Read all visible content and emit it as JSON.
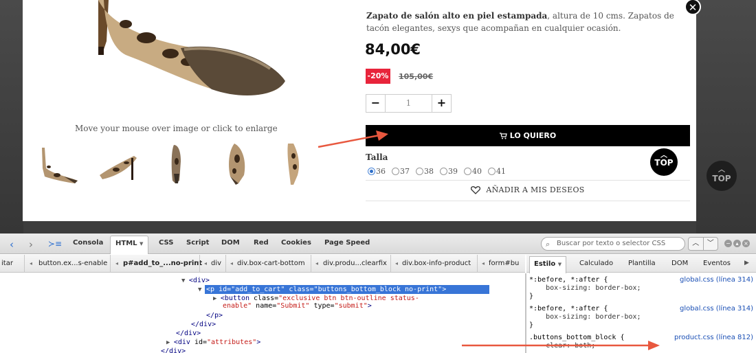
{
  "product": {
    "name_bold": "Zapato de salón alto en piel estampada",
    "description_rest": ", altura de 10 cms. Zapatos de tacón elegantes, sexys que acompañan en cualquier ocasión.",
    "price": "84,00€",
    "discount": "-20%",
    "old_price": "105,00€",
    "quantity": "1",
    "qty_minus": "−",
    "qty_plus": "+",
    "buy_label": "LO QUIERO",
    "buy_icon": "cart-icon",
    "size_label": "Talla",
    "sizes": [
      "36",
      "37",
      "38",
      "39",
      "40",
      "41"
    ],
    "selected_size": "36",
    "wishlist_label": "AÑADIR A MIS DESEOS",
    "enlarge_hint": "Move your mouse over image or click to enlarge",
    "top_label": "TOP",
    "close_symbol": "✕"
  },
  "background": {
    "top_label": "TOP"
  },
  "devtools": {
    "tabs": [
      "Consola",
      "HTML",
      "CSS",
      "Script",
      "DOM",
      "Red",
      "Cookies",
      "Page Speed"
    ],
    "active_tab": "HTML",
    "search_placeholder": "Buscar por texto o selector CSS",
    "breadcrumbs": [
      "itar",
      "button.ex...s-enable",
      "p#add_to_...no-print",
      "div",
      "div.box-cart-bottom",
      "div.produ...clearfix",
      "div.box-info-product",
      "form#bu"
    ],
    "side_tabs": [
      "Estilo",
      "Calculado",
      "Plantilla",
      "DOM",
      "Eventos"
    ],
    "active_side_tab": "Estilo",
    "html_lines": {
      "l1": "<div>",
      "l2_tag_open": "<p ",
      "l2_attr1": "id=",
      "l2_val1": "\"add_to_cart\"",
      "l2_attr2": " class=",
      "l2_val2": "\"buttons_bottom_block no-print\"",
      "l2_tag_close": ">",
      "l3_tag": "<button ",
      "l3_attr": "class=",
      "l3_val": "\"exclusive btn btn-outline status-",
      "l4_val": "enable\"",
      "l4_attr1": " name=",
      "l4_val1": "\"Submit\"",
      "l4_attr2": " type=",
      "l4_val2": "\"submit\"",
      "l4_close": ">",
      "l5": "</p>",
      "l6": "</div>",
      "l7": "</div>",
      "l8_tag": "<div ",
      "l8_attr": "id=",
      "l8_val": "\"attributes\"",
      "l8_close": ">",
      "l9": "</div>"
    },
    "css_rules": [
      {
        "selector": "*:before, *:after {",
        "prop": "    box-sizing: border-box;",
        "close": "}",
        "source": "global.css (línea 314)"
      },
      {
        "selector": "*:before, *:after {",
        "prop": "    box-sizing: border-box;",
        "close": "}",
        "source": "global.css (línea 314)"
      },
      {
        "selector": ".buttons_bottom_block {",
        "prop": "    clear: both;",
        "close": "",
        "source": "product.css (línea 812)"
      }
    ]
  },
  "colors": {
    "discount_red": "#e8243b",
    "selection_blue": "#3875d7",
    "arrow_red": "#e8583f"
  }
}
